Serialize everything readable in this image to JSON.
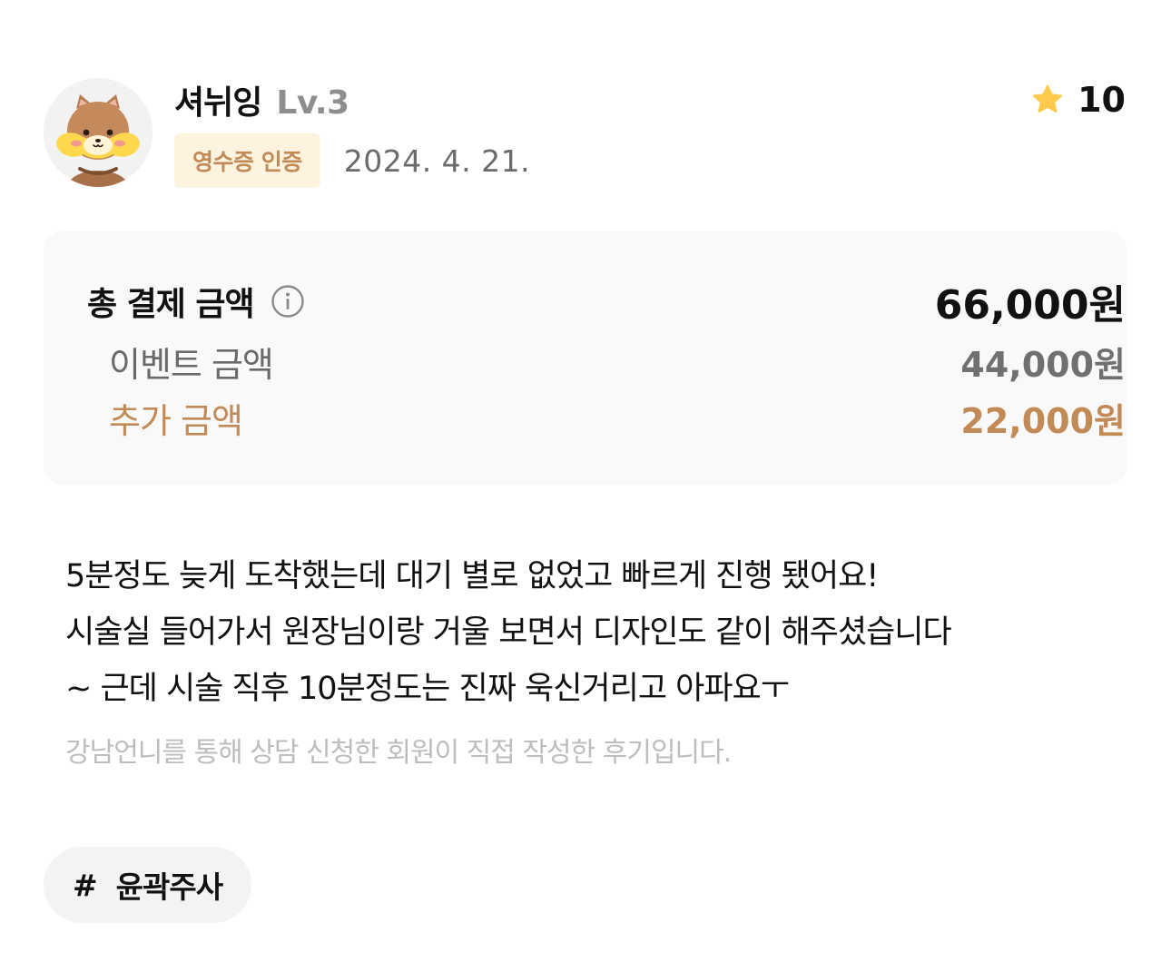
{
  "review": {
    "author": {
      "nickname": "셔뉘잉",
      "level": "Lv.3",
      "avatar_icon": "hamster-avatar-icon"
    },
    "rating": {
      "icon": "star-icon",
      "value": "10",
      "star_color": "#ffc94a"
    },
    "badge": {
      "label": "영수증 인증",
      "text_color": "#c28a56",
      "bg_color": "#fdf3df"
    },
    "date": "2024. 4. 21.",
    "price": {
      "total_label": "총 결제 금액",
      "total_info_icon": "info-icon",
      "total_amount": "66,000원",
      "event_label": "이벤트 금액",
      "event_amount": "44,000원",
      "extra_label": "추가 금액",
      "extra_amount": "22,000원",
      "accent_color": "#c28a56"
    },
    "body_lines": [
      "5분정도 늦게 도착했는데 대기 별로 없었고 빠르게 진행 됐어요!",
      "시술실 들어가서 원장님이랑 거울 보면서 디자인도 같이 해주셨습니다",
      "~ 근데 시술 직후 10분정도는 진짜 욱신거리고 아파요ㅜ"
    ],
    "notice": "강남언니를 통해 상담 신청한 회원이 직접 작성한 후기입니다.",
    "tags": [
      {
        "hash": "#",
        "label": "윤곽주사"
      }
    ]
  }
}
